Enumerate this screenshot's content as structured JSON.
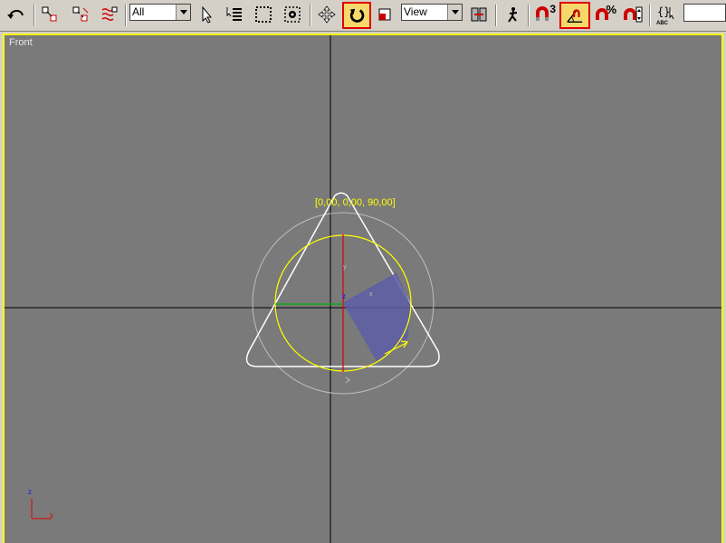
{
  "toolbar": {
    "selection_filter": "All",
    "reference_coord_system": "View",
    "snaps_toggle_superscript": "3",
    "percent_snap_symbol": "%",
    "edit_named_sets_label": "ABC",
    "named_selection_value": ""
  },
  "viewport": {
    "label": "Front",
    "rotation_readout": "[0,00, 0,00, 90,00]",
    "gizmo_axis_x": "x",
    "gizmo_axis_y": "y",
    "gizmo_axis_z": "z",
    "axis_tripod_x": "x",
    "axis_tripod_z": "z"
  },
  "colors": {
    "viewport_border": "#ffff00",
    "viewport_bg": "#7a7a7a",
    "active_button_highlight": "#e00000",
    "active_button_fill": "#f5d96b"
  }
}
